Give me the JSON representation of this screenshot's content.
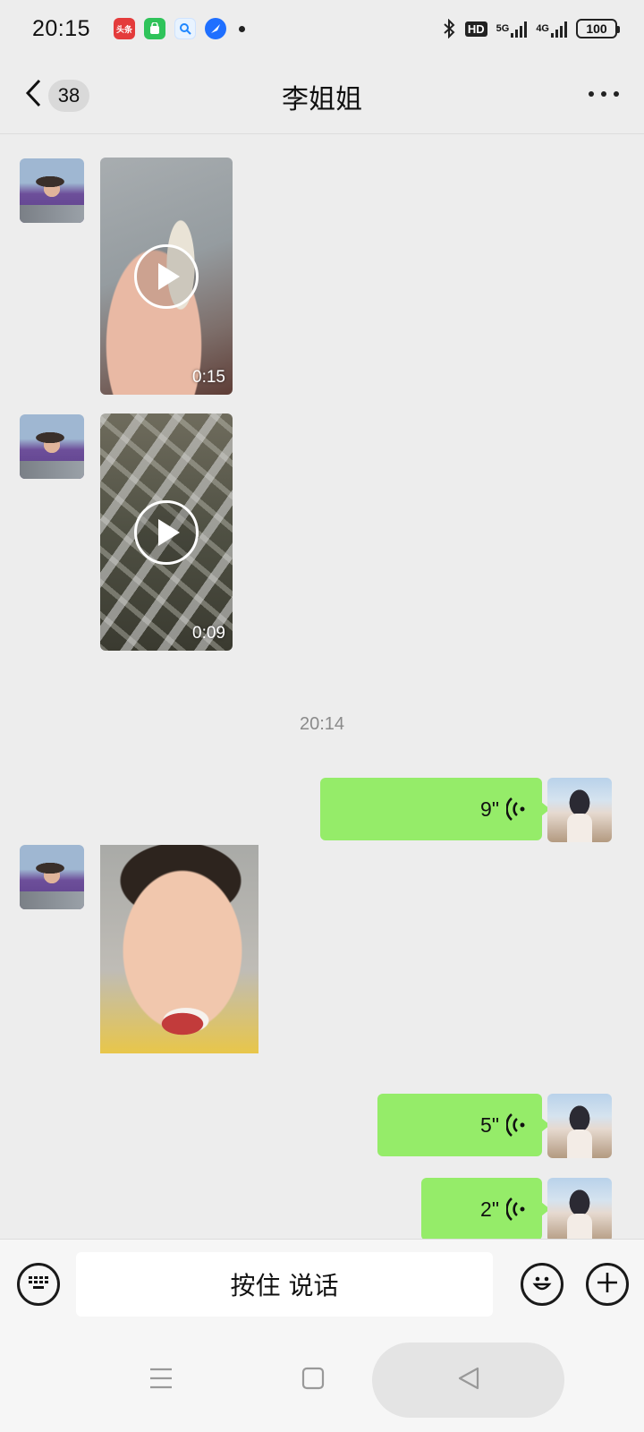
{
  "status_bar": {
    "time": "20:15",
    "app_icons": [
      "toutiao-icon",
      "app-store-icon",
      "search-app-icon",
      "browser-icon"
    ],
    "hd_label": "HD",
    "network_1": "5G",
    "network_2": "4G",
    "battery": "100"
  },
  "header": {
    "unread_count": "38",
    "title": "李姐姐"
  },
  "messages": {
    "video_1_duration": "0:15",
    "video_2_duration": "0:09",
    "time_divider": "20:14",
    "voice_1_duration": "9\"",
    "voice_2_duration": "5\"",
    "voice_3_duration": "2\""
  },
  "input_bar": {
    "hold_to_talk_label": "按住 说话"
  },
  "colors": {
    "chat_background": "#ededed",
    "voice_bubble": "#95ec69",
    "input_bar_background": "#f6f6f6"
  }
}
